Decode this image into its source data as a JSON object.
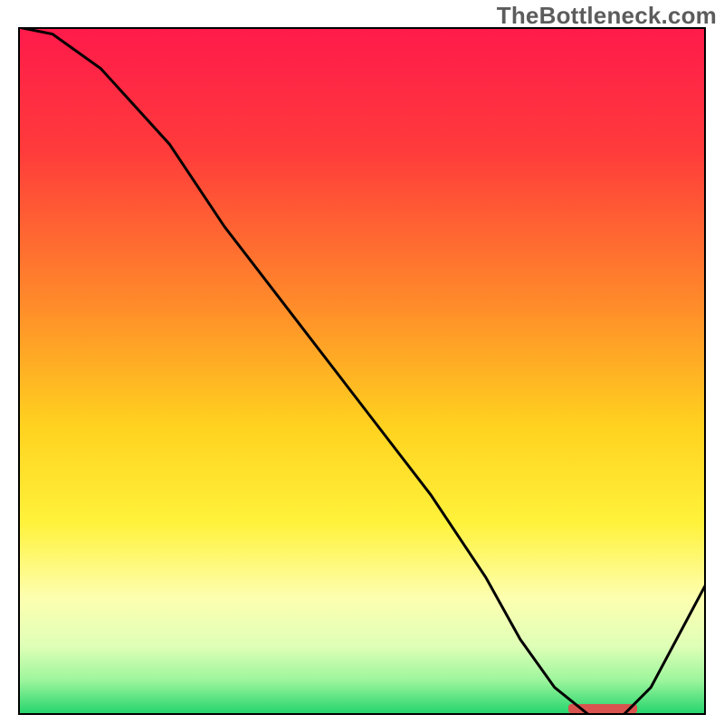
{
  "watermark": "TheBottleneck.com",
  "chart_data": {
    "type": "line",
    "title": "",
    "xlabel": "",
    "ylabel": "",
    "xlim": [
      0,
      100
    ],
    "ylim": [
      0,
      100
    ],
    "x": [
      0,
      5,
      12,
      22,
      30,
      40,
      50,
      60,
      68,
      73,
      78,
      83,
      88,
      92,
      100
    ],
    "values": [
      100,
      99,
      94,
      83,
      71,
      58,
      45,
      32,
      20,
      11,
      4,
      0,
      0,
      4,
      19
    ],
    "marker_region": {
      "x_start": 80,
      "x_end": 90,
      "y": 0
    },
    "background_gradient_stops": [
      {
        "offset": 0,
        "color": "#ff1a4b"
      },
      {
        "offset": 18,
        "color": "#ff3b3b"
      },
      {
        "offset": 40,
        "color": "#ff8a2a"
      },
      {
        "offset": 58,
        "color": "#ffd21f"
      },
      {
        "offset": 72,
        "color": "#fff23a"
      },
      {
        "offset": 83,
        "color": "#fdffb0"
      },
      {
        "offset": 90,
        "color": "#dfffb7"
      },
      {
        "offset": 95,
        "color": "#9cf59c"
      },
      {
        "offset": 100,
        "color": "#1fd36b"
      }
    ],
    "marker_color": "#d9544f",
    "line_color": "#000000",
    "line_width": 3,
    "frame_stroke": "#000000",
    "frame_width": 4
  }
}
